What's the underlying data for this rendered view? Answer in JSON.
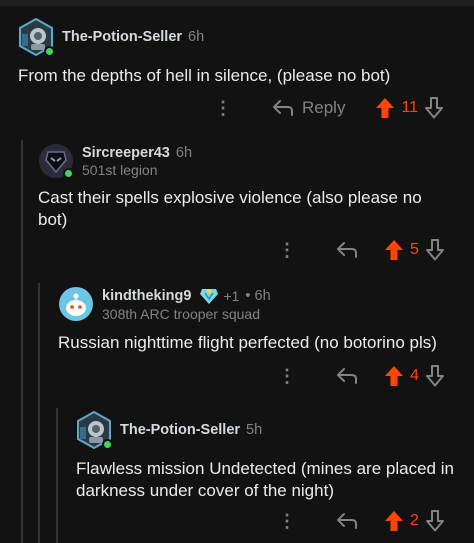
{
  "comments": [
    {
      "username": "The-Potion-Seller",
      "time": "6h",
      "text": "From the depths of hell in silence, (please no bot)",
      "reply_label": "Reply",
      "score": "11"
    },
    {
      "username": "Sircreeper43",
      "time": "6h",
      "flair": "501st legion",
      "text": "Cast their spells explosive violence (also please no bot)",
      "score": "5"
    },
    {
      "username": "kindtheking9",
      "award_count": "+1",
      "time": "• 6h",
      "flair": "308th ARC trooper squad",
      "text": "Russian nighttime flight perfected (no botorino pls)",
      "score": "4"
    },
    {
      "username": "The-Potion-Seller",
      "time": "5h",
      "text": "Flawless mission Undetected (mines are placed in darkness under cover of the night)",
      "score": "2"
    }
  ],
  "icons": {
    "options": "ellipsis-vertical-icon",
    "reply": "reply-arrow-icon",
    "upvote": "upvote-arrow-icon",
    "downvote": "downvote-arrow-icon",
    "award": "award-icon"
  },
  "colors": {
    "background": "#121212",
    "upvoted": "#ff4500",
    "online": "#46d160",
    "muted": "#818384",
    "thread_line": "#343536"
  }
}
